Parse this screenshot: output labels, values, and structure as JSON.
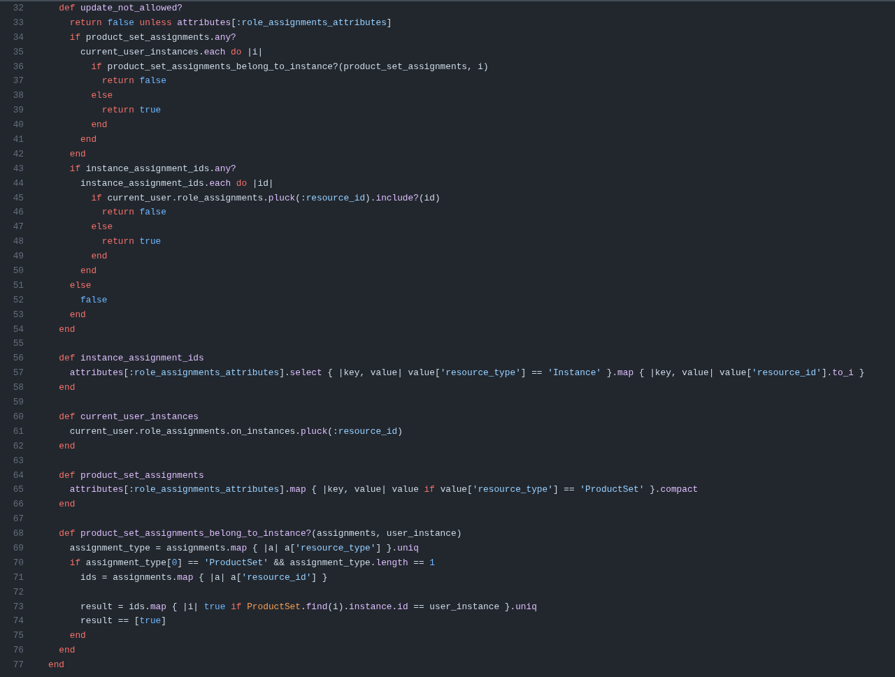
{
  "editor": {
    "lines": [
      {
        "number": "32",
        "tokens": [
          {
            "kind": "keyword",
            "text": "  def"
          },
          {
            "kind": "function",
            "text": " update_not_allowed?"
          }
        ]
      },
      {
        "number": "33",
        "tokens": [
          {
            "kind": "keyword",
            "text": "    return"
          },
          {
            "kind": "constant",
            "text": " false"
          },
          {
            "kind": "keyword",
            "text": " unless"
          },
          {
            "kind": "function",
            "text": " attributes"
          },
          {
            "kind": "plain",
            "text": "["
          },
          {
            "kind": "string",
            "text": ":role_assignments_attributes"
          },
          {
            "kind": "plain",
            "text": "]"
          }
        ]
      },
      {
        "number": "34",
        "tokens": [
          {
            "kind": "keyword",
            "text": "    if"
          },
          {
            "kind": "plain",
            "text": " product_set_assignments."
          },
          {
            "kind": "function",
            "text": "any?"
          }
        ]
      },
      {
        "number": "35",
        "tokens": [
          {
            "kind": "plain",
            "text": "      current_user_instances."
          },
          {
            "kind": "function",
            "text": "each"
          },
          {
            "kind": "keyword",
            "text": " do"
          },
          {
            "kind": "plain",
            "text": " |i|"
          }
        ]
      },
      {
        "number": "36",
        "tokens": [
          {
            "kind": "keyword",
            "text": "        if"
          },
          {
            "kind": "plain",
            "text": " product_set_assignments_belong_to_instance?(product_set_assignments, i)"
          }
        ]
      },
      {
        "number": "37",
        "tokens": [
          {
            "kind": "keyword",
            "text": "          return"
          },
          {
            "kind": "constant",
            "text": " false"
          }
        ]
      },
      {
        "number": "38",
        "tokens": [
          {
            "kind": "keyword",
            "text": "        else"
          }
        ]
      },
      {
        "number": "39",
        "tokens": [
          {
            "kind": "keyword",
            "text": "          return"
          },
          {
            "kind": "constant",
            "text": " true"
          }
        ]
      },
      {
        "number": "40",
        "tokens": [
          {
            "kind": "keyword",
            "text": "        end"
          }
        ]
      },
      {
        "number": "41",
        "tokens": [
          {
            "kind": "keyword",
            "text": "      end"
          }
        ]
      },
      {
        "number": "42",
        "tokens": [
          {
            "kind": "keyword",
            "text": "    end"
          }
        ]
      },
      {
        "number": "43",
        "tokens": [
          {
            "kind": "keyword",
            "text": "    if"
          },
          {
            "kind": "plain",
            "text": " instance_assignment_ids."
          },
          {
            "kind": "function",
            "text": "any?"
          }
        ]
      },
      {
        "number": "44",
        "tokens": [
          {
            "kind": "plain",
            "text": "      instance_assignment_ids."
          },
          {
            "kind": "function",
            "text": "each"
          },
          {
            "kind": "keyword",
            "text": " do"
          },
          {
            "kind": "plain",
            "text": " |id|"
          }
        ]
      },
      {
        "number": "45",
        "tokens": [
          {
            "kind": "keyword",
            "text": "        if"
          },
          {
            "kind": "plain",
            "text": " current_user.role_assignments."
          },
          {
            "kind": "function",
            "text": "pluck"
          },
          {
            "kind": "plain",
            "text": "("
          },
          {
            "kind": "string",
            "text": ":resource_id"
          },
          {
            "kind": "plain",
            "text": ")."
          },
          {
            "kind": "function",
            "text": "include?"
          },
          {
            "kind": "plain",
            "text": "(id)"
          }
        ]
      },
      {
        "number": "46",
        "tokens": [
          {
            "kind": "keyword",
            "text": "          return"
          },
          {
            "kind": "constant",
            "text": " false"
          }
        ]
      },
      {
        "number": "47",
        "tokens": [
          {
            "kind": "keyword",
            "text": "        else"
          }
        ]
      },
      {
        "number": "48",
        "tokens": [
          {
            "kind": "keyword",
            "text": "          return"
          },
          {
            "kind": "constant",
            "text": " true"
          }
        ]
      },
      {
        "number": "49",
        "tokens": [
          {
            "kind": "keyword",
            "text": "        end"
          }
        ]
      },
      {
        "number": "50",
        "tokens": [
          {
            "kind": "keyword",
            "text": "      end"
          }
        ]
      },
      {
        "number": "51",
        "tokens": [
          {
            "kind": "keyword",
            "text": "    else"
          }
        ]
      },
      {
        "number": "52",
        "tokens": [
          {
            "kind": "constant",
            "text": "      false"
          }
        ]
      },
      {
        "number": "53",
        "tokens": [
          {
            "kind": "keyword",
            "text": "    end"
          }
        ]
      },
      {
        "number": "54",
        "tokens": [
          {
            "kind": "keyword",
            "text": "  end"
          }
        ]
      },
      {
        "number": "55"
      },
      {
        "number": "56",
        "tokens": [
          {
            "kind": "keyword",
            "text": "  def"
          },
          {
            "kind": "function",
            "text": " instance_assignment_ids"
          }
        ]
      },
      {
        "number": "57",
        "tokens": [
          {
            "kind": "function",
            "text": "    attributes"
          },
          {
            "kind": "plain",
            "text": "["
          },
          {
            "kind": "string",
            "text": ":role_assignments_attributes"
          },
          {
            "kind": "plain",
            "text": "]."
          },
          {
            "kind": "function",
            "text": "select"
          },
          {
            "kind": "plain",
            "text": " { |key, value| value["
          },
          {
            "kind": "string",
            "text": "'resource_type'"
          },
          {
            "kind": "plain",
            "text": "] == "
          },
          {
            "kind": "string",
            "text": "'Instance'"
          },
          {
            "kind": "plain",
            "text": " }."
          },
          {
            "kind": "function",
            "text": "map"
          },
          {
            "kind": "plain",
            "text": " { |key, value| value["
          },
          {
            "kind": "string",
            "text": "'resource_id'"
          },
          {
            "kind": "plain",
            "text": "]."
          },
          {
            "kind": "function",
            "text": "to_i"
          },
          {
            "kind": "plain",
            "text": " }"
          }
        ]
      },
      {
        "number": "58",
        "tokens": [
          {
            "kind": "keyword",
            "text": "  end"
          }
        ]
      },
      {
        "number": "59"
      },
      {
        "number": "60",
        "tokens": [
          {
            "kind": "keyword",
            "text": "  def"
          },
          {
            "kind": "function",
            "text": " current_user_instances"
          }
        ]
      },
      {
        "number": "61",
        "tokens": [
          {
            "kind": "plain",
            "text": "    current_user.role_assignments.on_instances."
          },
          {
            "kind": "function",
            "text": "pluck"
          },
          {
            "kind": "plain",
            "text": "("
          },
          {
            "kind": "string",
            "text": ":resource_id"
          },
          {
            "kind": "plain",
            "text": ")"
          }
        ]
      },
      {
        "number": "62",
        "tokens": [
          {
            "kind": "keyword",
            "text": "  end"
          }
        ]
      },
      {
        "number": "63"
      },
      {
        "number": "64",
        "tokens": [
          {
            "kind": "keyword",
            "text": "  def"
          },
          {
            "kind": "function",
            "text": " product_set_assignments"
          }
        ]
      },
      {
        "number": "65",
        "tokens": [
          {
            "kind": "function",
            "text": "    attributes"
          },
          {
            "kind": "plain",
            "text": "["
          },
          {
            "kind": "string",
            "text": ":role_assignments_attributes"
          },
          {
            "kind": "plain",
            "text": "]."
          },
          {
            "kind": "function",
            "text": "map"
          },
          {
            "kind": "plain",
            "text": " { |key, value| value "
          },
          {
            "kind": "keyword",
            "text": "if"
          },
          {
            "kind": "plain",
            "text": " value["
          },
          {
            "kind": "string",
            "text": "'resource_type'"
          },
          {
            "kind": "plain",
            "text": "] == "
          },
          {
            "kind": "string",
            "text": "'ProductSet'"
          },
          {
            "kind": "plain",
            "text": " }."
          },
          {
            "kind": "function",
            "text": "compact"
          }
        ]
      },
      {
        "number": "66",
        "tokens": [
          {
            "kind": "keyword",
            "text": "  end"
          }
        ]
      },
      {
        "number": "67"
      },
      {
        "number": "68",
        "tokens": [
          {
            "kind": "keyword",
            "text": "  def"
          },
          {
            "kind": "function",
            "text": " product_set_assignments_belong_to_instance?"
          },
          {
            "kind": "plain",
            "text": "(assignments, user_instance)"
          }
        ]
      },
      {
        "number": "69",
        "tokens": [
          {
            "kind": "plain",
            "text": "    assignment_type = assignments."
          },
          {
            "kind": "function",
            "text": "map"
          },
          {
            "kind": "plain",
            "text": " { |a| a["
          },
          {
            "kind": "string",
            "text": "'resource_type'"
          },
          {
            "kind": "plain",
            "text": "] }."
          },
          {
            "kind": "function",
            "text": "uniq"
          }
        ]
      },
      {
        "number": "70",
        "tokens": [
          {
            "kind": "keyword",
            "text": "    if"
          },
          {
            "kind": "plain",
            "text": " assignment_type["
          },
          {
            "kind": "constant",
            "text": "0"
          },
          {
            "kind": "plain",
            "text": "] == "
          },
          {
            "kind": "string",
            "text": "'ProductSet'"
          },
          {
            "kind": "plain",
            "text": " && assignment_type."
          },
          {
            "kind": "function",
            "text": "length"
          },
          {
            "kind": "plain",
            "text": " == "
          },
          {
            "kind": "constant",
            "text": "1"
          }
        ]
      },
      {
        "number": "71",
        "tokens": [
          {
            "kind": "plain",
            "text": "      ids = assignments."
          },
          {
            "kind": "function",
            "text": "map"
          },
          {
            "kind": "plain",
            "text": " { |a| a["
          },
          {
            "kind": "string",
            "text": "'resource_id'"
          },
          {
            "kind": "plain",
            "text": "] }"
          }
        ]
      },
      {
        "number": "72"
      },
      {
        "number": "73",
        "tokens": [
          {
            "kind": "plain",
            "text": "      result = ids."
          },
          {
            "kind": "function",
            "text": "map"
          },
          {
            "kind": "plain",
            "text": " { |i| "
          },
          {
            "kind": "constant",
            "text": "true"
          },
          {
            "kind": "keyword",
            "text": " if"
          },
          {
            "kind": "class",
            "text": " ProductSet"
          },
          {
            "kind": "plain",
            "text": "."
          },
          {
            "kind": "function",
            "text": "find"
          },
          {
            "kind": "plain",
            "text": "(i)."
          },
          {
            "kind": "function",
            "text": "instance"
          },
          {
            "kind": "plain",
            "text": "."
          },
          {
            "kind": "function",
            "text": "id"
          },
          {
            "kind": "plain",
            "text": " == user_instance }."
          },
          {
            "kind": "function",
            "text": "uniq"
          }
        ]
      },
      {
        "number": "74",
        "tokens": [
          {
            "kind": "plain",
            "text": "      result == ["
          },
          {
            "kind": "constant",
            "text": "true"
          },
          {
            "kind": "plain",
            "text": "]"
          }
        ]
      },
      {
        "number": "75",
        "tokens": [
          {
            "kind": "keyword",
            "text": "    end"
          }
        ]
      },
      {
        "number": "76",
        "tokens": [
          {
            "kind": "keyword",
            "text": "  end"
          }
        ]
      },
      {
        "number": "77",
        "tokens": [
          {
            "kind": "keyword",
            "text": "end"
          }
        ]
      }
    ]
  }
}
